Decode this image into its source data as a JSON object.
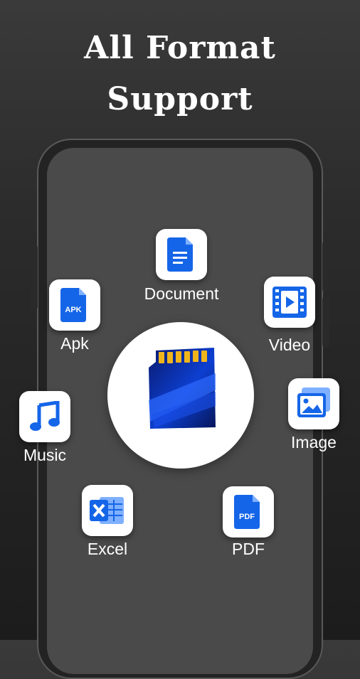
{
  "headline": {
    "line1": "All Format",
    "line2": "Support"
  },
  "formats": {
    "document": {
      "label": "Document",
      "icon": "document-icon"
    },
    "apk": {
      "label": "Apk",
      "icon": "apk-file-icon",
      "badge": "APK"
    },
    "video": {
      "label": "Video",
      "icon": "video-film-icon"
    },
    "music": {
      "label": "Music",
      "icon": "music-note-icon"
    },
    "image": {
      "label": "Image",
      "icon": "image-gallery-icon"
    },
    "excel": {
      "label": "Excel",
      "icon": "excel-sheet-icon"
    },
    "pdf": {
      "label": "PDF",
      "icon": "pdf-file-icon",
      "badge": "PDF"
    }
  },
  "center": {
    "icon": "sd-card-icon"
  },
  "colors": {
    "accent": "#1565E8",
    "background": "#2b2b2b",
    "tile": "#ffffff",
    "text": "#ffffff"
  }
}
